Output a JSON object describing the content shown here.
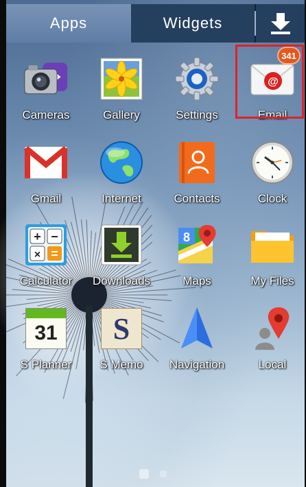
{
  "tabs": {
    "apps_label": "Apps",
    "widgets_label": "Widgets",
    "download_icon": "download-icon"
  },
  "apps": [
    {
      "label": "Cameras",
      "icon": "cameras-icon"
    },
    {
      "label": "Gallery",
      "icon": "gallery-icon"
    },
    {
      "label": "Settings",
      "icon": "settings-icon"
    },
    {
      "label": "Email",
      "icon": "email-icon",
      "badge": "341"
    },
    {
      "label": "Gmail",
      "icon": "gmail-icon"
    },
    {
      "label": "Internet",
      "icon": "internet-icon"
    },
    {
      "label": "Contacts",
      "icon": "contacts-icon"
    },
    {
      "label": "Clock",
      "icon": "clock-icon"
    },
    {
      "label": "Calculator",
      "icon": "calculator-icon"
    },
    {
      "label": "Downloads",
      "icon": "downloads-icon"
    },
    {
      "label": "Maps",
      "icon": "maps-icon"
    },
    {
      "label": "My Files",
      "icon": "my-files-icon"
    },
    {
      "label": "S Planner",
      "icon": "s-planner-icon",
      "date": "31"
    },
    {
      "label": "S Memo",
      "icon": "s-memo-icon",
      "letter": "S"
    },
    {
      "label": "Navigation",
      "icon": "navigation-icon"
    },
    {
      "label": "Local",
      "icon": "local-icon"
    }
  ],
  "colors": {
    "highlight": "#e0202c",
    "badge": "#e2581e",
    "tab_bar": "#0d2338"
  },
  "page_indicator": {
    "pages": 2,
    "current": 1
  }
}
